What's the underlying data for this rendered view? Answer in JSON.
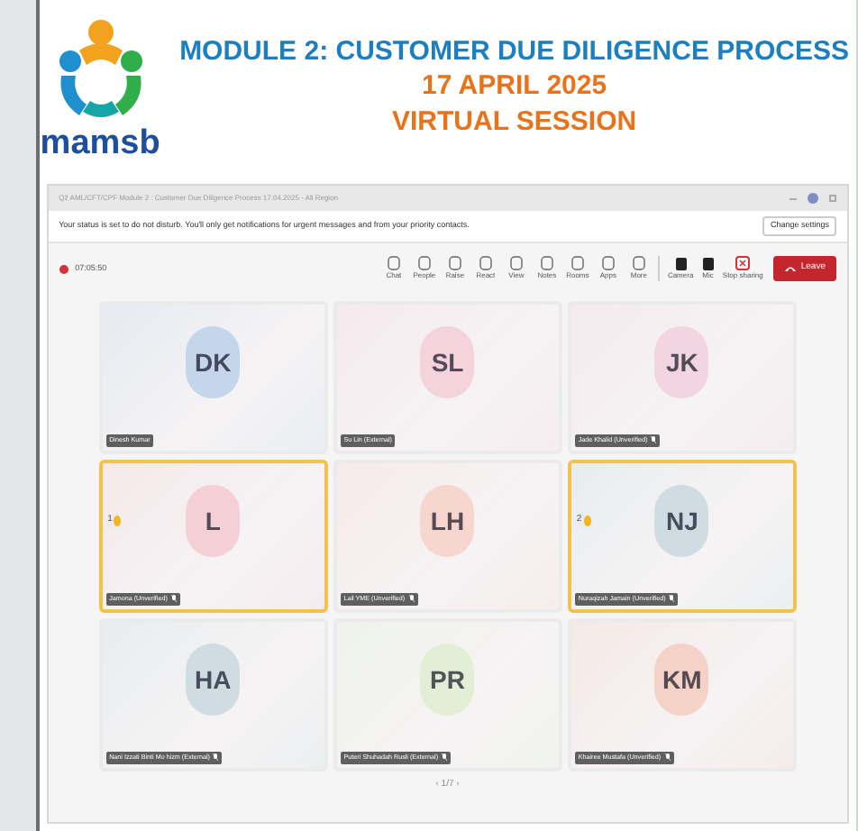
{
  "header": {
    "brand": "mamsb",
    "title": "MODULE 2: CUSTOMER DUE DILIGENCE PROCESS",
    "date": "17 APRIL 2025",
    "session": "VIRTUAL SESSION"
  },
  "meeting": {
    "window_title": "Q2 AML/CFT/CPF Module 2 : Customer Due Diligence Process 17.04.2025 - All Region",
    "notice": "Your status is set to do not disturb. You'll only get notifications for urgent messages and from your priority contacts.",
    "notice_button": "Change settings",
    "timer": "07:05:50",
    "toolbar": [
      {
        "label": "Chat"
      },
      {
        "label": "People"
      },
      {
        "label": "Raise"
      },
      {
        "label": "React"
      },
      {
        "label": "View"
      },
      {
        "label": "Notes"
      },
      {
        "label": "Rooms"
      },
      {
        "label": "Apps"
      },
      {
        "label": "More"
      }
    ],
    "devices": [
      {
        "label": "Camera"
      },
      {
        "label": "Mic"
      }
    ],
    "stop_sharing": "Stop sharing",
    "leave": "Leave",
    "participants": [
      {
        "initials": "DK",
        "name": "Dinesh Kumar",
        "muted": false,
        "highlighted": false,
        "color": "#c5d6ea"
      },
      {
        "initials": "SL",
        "name": "Su Lin (External)",
        "muted": false,
        "highlighted": false,
        "color": "#f5d3dc"
      },
      {
        "initials": "JK",
        "name": "Jade Khalid (Unverified)",
        "muted": true,
        "highlighted": false,
        "color": "#f1d6e1"
      },
      {
        "initials": "L",
        "name": "Jamona (Unverified)",
        "muted": true,
        "highlighted": true,
        "hand": "1",
        "color": "#f4d0d6"
      },
      {
        "initials": "LH",
        "name": "Lail YME (Unverified)",
        "muted": true,
        "highlighted": false,
        "color": "#f8d6d0"
      },
      {
        "initials": "NJ",
        "name": "Nuraqizah Jamain (Unverified)",
        "muted": true,
        "highlighted": true,
        "hand": "2",
        "color": "#cfdde3"
      },
      {
        "initials": "HA",
        "name": "Nani Izzati Binti Mo hizm (External)",
        "muted": true,
        "highlighted": false,
        "color": "#cfdde3"
      },
      {
        "initials": "PR",
        "name": "Puteri Shuhadah Rusli (External)",
        "muted": true,
        "highlighted": false,
        "color": "#e2efd6"
      },
      {
        "initials": "KM",
        "name": "Khairee Mustafa (Unverified)",
        "muted": true,
        "highlighted": false,
        "color": "#f4d2c8"
      }
    ],
    "pager": "‹ 1/7 ›"
  }
}
